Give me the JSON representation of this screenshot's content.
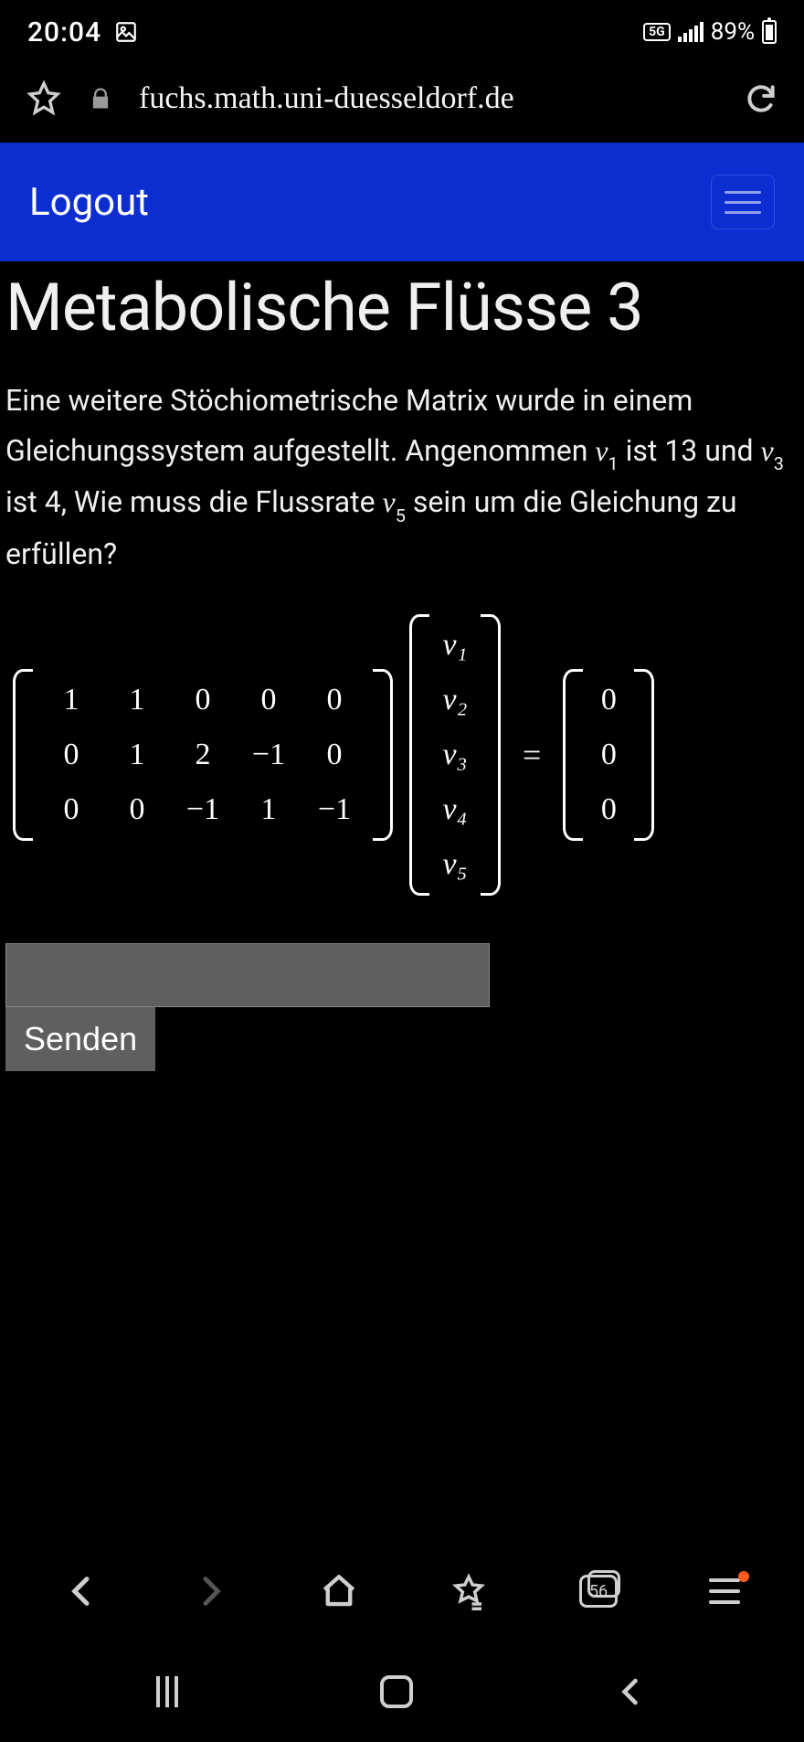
{
  "status": {
    "time": "20:04",
    "network": "5G",
    "battery_pct": "89%"
  },
  "browser": {
    "url": "fuchs.math.uni-duesseldorf.de"
  },
  "appbar": {
    "logout": "Logout"
  },
  "page": {
    "title": "Metabolische Flüsse 3",
    "question_parts": {
      "p1": "Eine weitere Stöchiometrische Matrix wurde in einem Gleichungssystem aufgestellt. Angenommen ",
      "v1": "v",
      "s1": "1",
      "p2": " ist 13 und ",
      "v3": "v",
      "s3": "3",
      "p3": " ist 4, Wie muss die Flussrate ",
      "v5": "v",
      "s5": "5",
      "p4": " sein um die Gleichung zu erfüllen?"
    },
    "matrixA": [
      [
        "1",
        "1",
        "0",
        "0",
        "0"
      ],
      [
        "0",
        "1",
        "2",
        "−1",
        "0"
      ],
      [
        "0",
        "0",
        "−1",
        "1",
        "−1"
      ]
    ],
    "vecV": [
      "v₁",
      "v₂",
      "v₃",
      "v₄",
      "v₅"
    ],
    "eq": "=",
    "vecZero": [
      "0",
      "0",
      "0"
    ],
    "send": "Senden",
    "tabs": "56"
  }
}
